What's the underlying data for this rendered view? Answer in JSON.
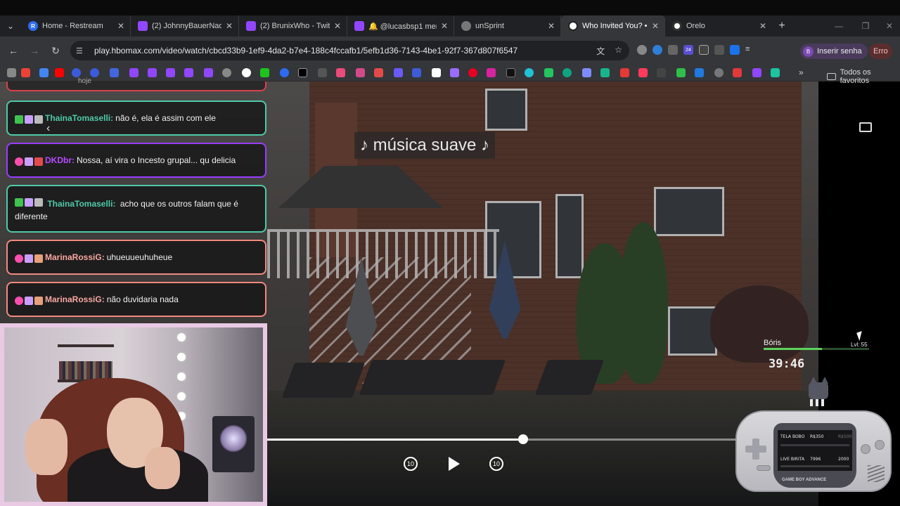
{
  "browser": {
    "tabs": [
      {
        "label": "Home - Restream",
        "fav_color": "#2e6bf0",
        "fav_letter": "R",
        "active": false
      },
      {
        "label": "(2) JohnnyBauerNao",
        "fav_color": "#9146ff",
        "fav_letter": "",
        "active": false
      },
      {
        "label": "(2) BrunixWho - Twit",
        "fav_color": "#9146ff",
        "fav_letter": "",
        "active": false
      },
      {
        "label": "🔔 @lucasbsp1 men",
        "fav_color": "#9146ff",
        "fav_letter": "",
        "active": false
      },
      {
        "label": "unSprint",
        "fav_color": "#888888",
        "fav_letter": "",
        "active": false
      },
      {
        "label": "Who Invited You? • H",
        "fav_color": "#ffffff",
        "fav_letter": "",
        "active": true
      },
      {
        "label": "Orelo",
        "fav_color": "#ffffff",
        "fav_letter": "",
        "active": false
      }
    ],
    "new_tab": "+",
    "url": "play.hbomax.com/video/watch/cbcd33b9-1ef9-4da2-b7e4-188c4fccafb1/5efb1d36-7143-4be1-92f7-367d807f6547",
    "profile_label": "Inserir senha",
    "profile_initial": "B",
    "error_label": "Erro",
    "extension_badge": "24",
    "bookmarks_folder": "Todos os favoritos",
    "bookmarks_more": "»"
  },
  "video": {
    "subtitle": "♪ música suave ♪",
    "progress": 0.545
  },
  "chat": {
    "sliver_text": "hoje",
    "messages": [
      {
        "user": "ThainaTomaselli:",
        "text": "não é, ela é assim com ele",
        "user_color": "#4ec9a8",
        "border": "#4ec9a8"
      },
      {
        "user": "DKDbr:",
        "text": "Nossa, aí vira o Incesto grupal... qu delicia",
        "user_color": "#b64bff",
        "border": "#9a3cff"
      },
      {
        "user": "ThainaTomaselli:",
        "text": "acho que os outros falam que é diferente",
        "user_color": "#4ec9a8",
        "border": "#4ec9a8"
      },
      {
        "user": "MarinaRossiG:",
        "text": "uhueuueuhuheue",
        "user_color": "#f6a8a0",
        "border": "#f08a80"
      },
      {
        "user": "MarinaRossiG:",
        "text": "não duvidaria nada",
        "user_color": "#f6a8a0",
        "border": "#f08a80"
      }
    ]
  },
  "game": {
    "name": "Bóris",
    "level": "Lvl: 55",
    "xp_fill": 0.55,
    "timer": "39:46",
    "row1_label": "TELA BOBO",
    "row1_value": "R$350",
    "row1_goal": "R$500",
    "row2_label": "LIVE BIRITA",
    "row2_value": "7996",
    "row2_goal": "2000",
    "brand": "GAME BOY ADVANCE"
  }
}
